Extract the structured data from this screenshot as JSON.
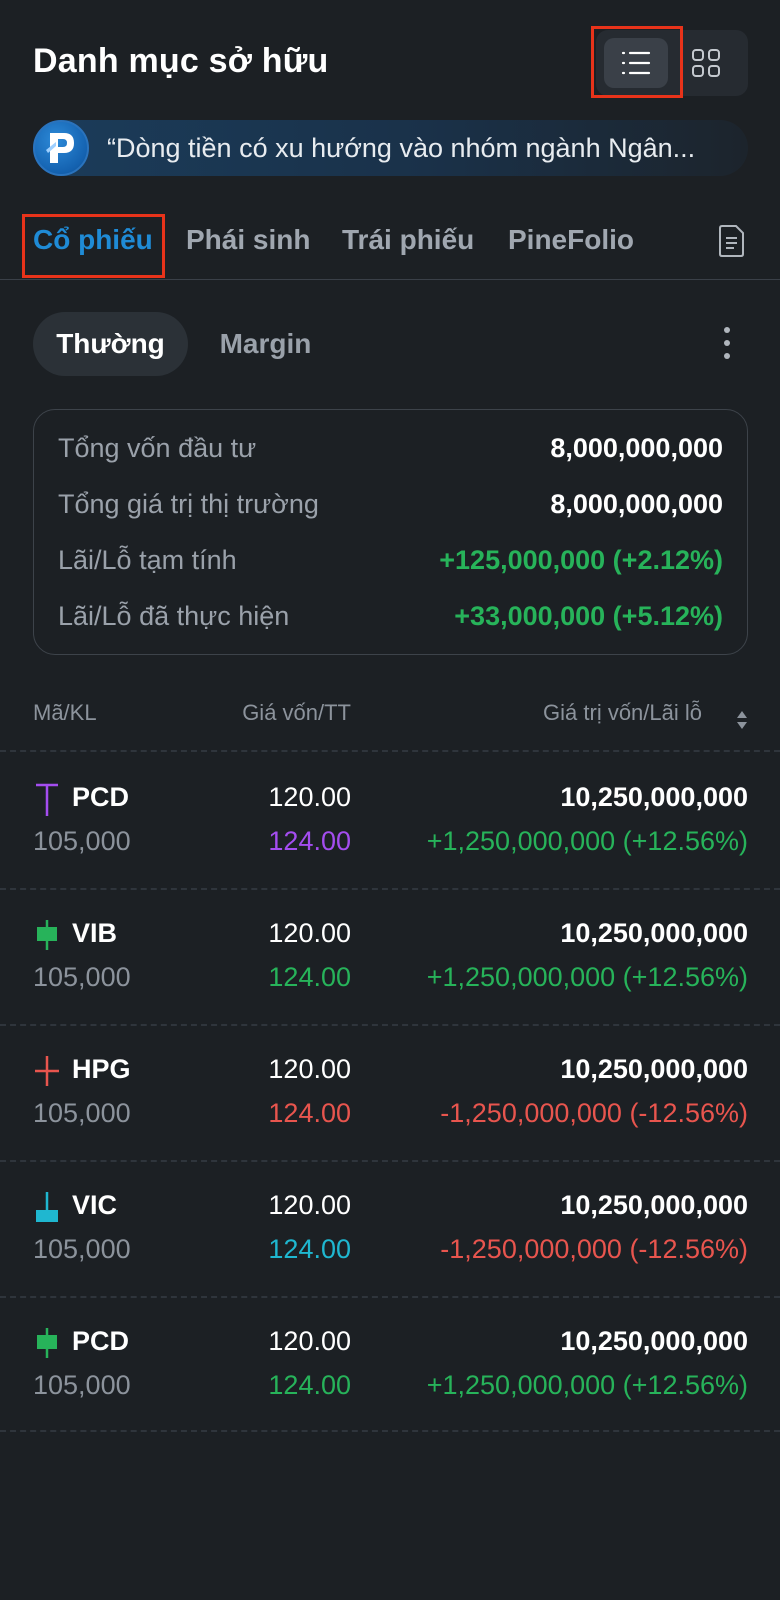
{
  "header": {
    "title": "Danh mục sở hữu",
    "view_modes": [
      "list-icon",
      "grid-icon"
    ],
    "active_view": "list"
  },
  "news": {
    "logo": "pinetree-logo",
    "text": "“Dòng tiền có xu hướng vào nhóm ngành Ngân..."
  },
  "tabs": [
    {
      "label": "Cổ phiếu",
      "active": true
    },
    {
      "label": "Phái sinh",
      "active": false
    },
    {
      "label": "Trái phiếu",
      "active": false
    },
    {
      "label": "PineFolio",
      "active": false
    }
  ],
  "subtabs": [
    {
      "label": "Thường",
      "active": true
    },
    {
      "label": "Margin",
      "active": false
    }
  ],
  "summary": [
    {
      "label": "Tổng vốn đầu tư",
      "value": "8,000,000,000"
    },
    {
      "label": "Tổng giá trị thị trường",
      "value": "8,000,000,000"
    },
    {
      "label": "Lãi/Lỗ tạm tính",
      "value": "+125,000,000 (+2.12%)"
    },
    {
      "label": "Lãi/Lỗ đã thực hiện",
      "value": "+33,000,000 (+5.12%)"
    }
  ],
  "table": {
    "headers": {
      "symbol_volume": "Mã/KL",
      "cost_market": "Giá vốn/TT",
      "value_pnl": "Giá trị vốn/Lãi lỗ"
    },
    "rows": [
      {
        "symbol": "PCD",
        "volume": "105,000",
        "cost": "120.00",
        "market": "124.00",
        "value": "10,250,000,000",
        "pnl": "+1,250,000,000 (+12.56%)",
        "market_color": "#a44df0",
        "pnl_color": "#27b35a",
        "icon": "ceiling-candle-icon"
      },
      {
        "symbol": "VIB",
        "volume": "105,000",
        "cost": "120.00",
        "market": "124.00",
        "value": "10,250,000,000",
        "pnl": "+1,250,000,000 (+12.56%)",
        "market_color": "#27b35a",
        "pnl_color": "#27b35a",
        "icon": "up-candle-icon"
      },
      {
        "symbol": "HPG",
        "volume": "105,000",
        "cost": "120.00",
        "market": "124.00",
        "value": "10,250,000,000",
        "pnl": "-1,250,000,000 (-12.56%)",
        "market_color": "#e8554e",
        "pnl_color": "#e8554e",
        "icon": "down-cross-icon"
      },
      {
        "symbol": "VIC",
        "volume": "105,000",
        "cost": "120.00",
        "market": "124.00",
        "value": "10,250,000,000",
        "pnl": "-1,250,000,000 (-12.56%)",
        "market_color": "#1fb7d0",
        "pnl_color": "#e8554e",
        "icon": "floor-candle-icon"
      },
      {
        "symbol": "PCD",
        "volume": "105,000",
        "cost": "120.00",
        "market": "124.00",
        "value": "10,250,000,000",
        "pnl": "+1,250,000,000 (+12.56%)",
        "market_color": "#27b35a",
        "pnl_color": "#27b35a",
        "icon": "up-candle-icon"
      }
    ]
  },
  "colors": {
    "background": "#1c2024",
    "accent": "#1f8bd6",
    "positive": "#27b35a",
    "negative": "#e8554e",
    "ceiling": "#a44df0",
    "floor": "#1fb7d0",
    "highlight": "#e8331a"
  }
}
